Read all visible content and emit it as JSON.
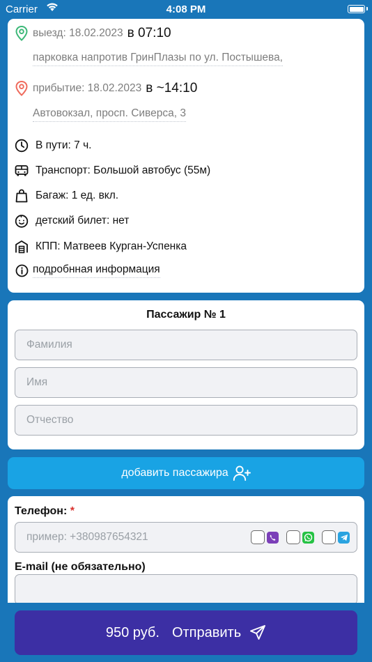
{
  "status_bar": {
    "carrier": "Carrier",
    "time": "4:08 PM"
  },
  "trip": {
    "departure_label": "выезд: 18.02.2023",
    "departure_time": "в 07:10",
    "departure_place": "парковка напротив ГринПлазы по ул. Постышева,",
    "arrival_label": "прибытие: 18.02.2023",
    "arrival_time": "в ~14:10",
    "arrival_place": "Автовокзал, просп. Сиверса, 3",
    "details": [
      {
        "icon": "clock-icon",
        "text": "В пути: 7 ч."
      },
      {
        "icon": "bus-icon",
        "text": "Транспорт: Большой автобус (55м)"
      },
      {
        "icon": "bag-icon",
        "text": "Багаж: 1 ед. вкл."
      },
      {
        "icon": "child-face-icon",
        "text": "детский билет: нет"
      },
      {
        "icon": "checkpoint-icon",
        "text": "КПП: Матвеев Курган-Успенка"
      }
    ],
    "more_info": "подробнная информация"
  },
  "passenger": {
    "title": "Пассажир № 1",
    "surname_placeholder": "Фамилия",
    "name_placeholder": "Имя",
    "patronymic_placeholder": "Отчество"
  },
  "add_passenger_label": "добавить пассажира",
  "contact": {
    "phone_label": "Телефон:",
    "required_mark": "*",
    "phone_placeholder": "пример: +380987654321",
    "email_label": "E-mail (не обязательно)",
    "messengers": [
      "viber-icon",
      "whatsapp-icon",
      "telegram-icon"
    ]
  },
  "submit": {
    "price": "950 руб.",
    "label": "Отправить"
  },
  "colors": {
    "background": "#1976b9",
    "add_button": "#19a3e4",
    "submit_button": "#3c2fa4",
    "departure_pin": "#3cb878",
    "arrival_pin": "#ef6b5d",
    "viber": "#7b3fb8",
    "whatsapp": "#25c244",
    "telegram": "#2aa3e0"
  }
}
